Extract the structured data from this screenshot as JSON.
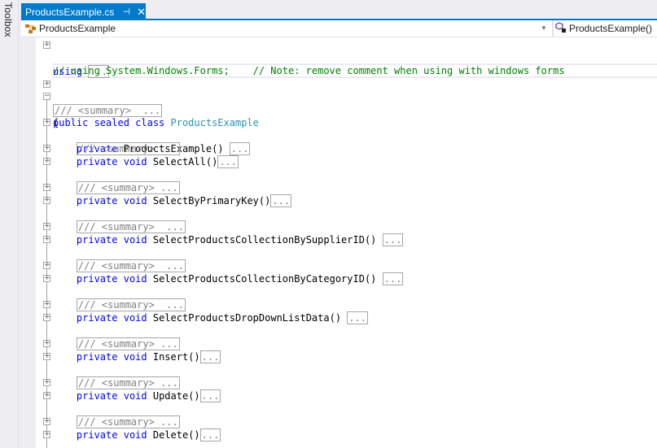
{
  "toolbox": {
    "label": "Toolbox"
  },
  "tab": {
    "title": "ProductsExample.cs",
    "pin_icon": "⊣",
    "close_icon": "✕"
  },
  "navbar": {
    "left": {
      "icon": "class-icon",
      "label": "ProductsExample"
    },
    "right": {
      "icon": "method-private-icon",
      "label": "ProductsExample()"
    }
  },
  "code": {
    "using_kw": "using",
    "collapsed": "...",
    "comment_line": "// using System.Windows.Forms;    // Note: remove comment when using with windows forms",
    "class_summary": "/// <summary>  ...",
    "class_decl_kw": "public sealed class ",
    "class_name": "ProductsExample",
    "open_brace": "{",
    "private_kw": "private",
    "void_kw": "void",
    "constructor": "ProductsExample()",
    "members": [
      {
        "summary": "/// <summary> ...",
        "name": "SelectAll()",
        "spaced": false
      },
      {
        "summary": "/// <summary> ...",
        "name": "SelectByPrimaryKey()",
        "spaced": false
      },
      {
        "summary": "/// <summary>  ...",
        "name": "SelectProductsCollectionBySupplierID()",
        "spaced": true
      },
      {
        "summary": "/// <summary>  ...",
        "name": "SelectProductsCollectionByCategoryID()",
        "spaced": true
      },
      {
        "summary": "/// <summary>  ...",
        "name": "SelectProductsDropDownListData()",
        "spaced": true
      },
      {
        "summary": "/// <summary> ...",
        "name": "Insert()",
        "spaced": false
      },
      {
        "summary": "/// <summary> ...",
        "name": "Update()",
        "spaced": false
      },
      {
        "summary": "/// <summary> ...",
        "name": "Delete()",
        "spaced": false
      }
    ]
  }
}
